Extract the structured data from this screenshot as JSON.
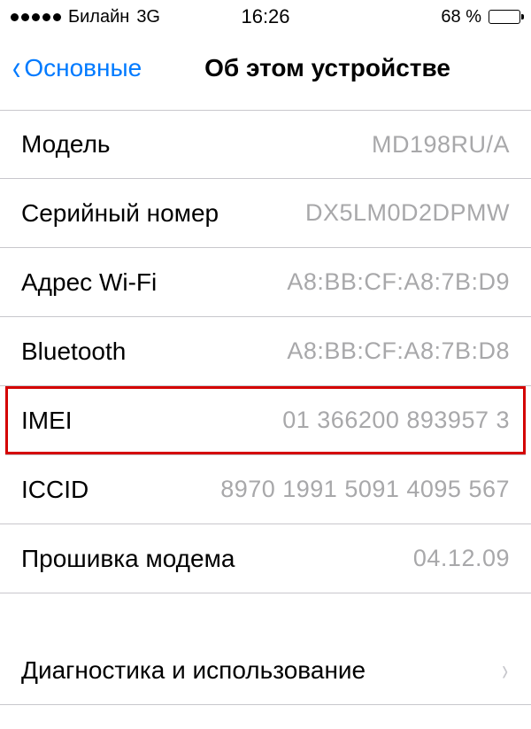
{
  "status_bar": {
    "carrier": "Билайн",
    "network": "3G",
    "time": "16:26",
    "battery_pct": "68 %"
  },
  "nav": {
    "back_label": "Основные",
    "title": "Об этом устройстве"
  },
  "rows": {
    "model": {
      "label": "Модель",
      "value": "MD198RU/A"
    },
    "serial": {
      "label": "Серийный номер",
      "value": "DX5LM0D2DPMW"
    },
    "wifi": {
      "label": "Адрес Wi-Fi",
      "value": "A8:BB:CF:A8:7B:D9"
    },
    "bluetooth": {
      "label": "Bluetooth",
      "value": "A8:BB:CF:A8:7B:D8"
    },
    "imei": {
      "label": "IMEI",
      "value": "01 366200 893957 3"
    },
    "iccid": {
      "label": "ICCID",
      "value": "8970 1991 5091 4095 567"
    },
    "firmware": {
      "label": "Прошивка модема",
      "value": "04.12.09"
    },
    "diagnostics": {
      "label": "Диагностика и использование"
    }
  }
}
